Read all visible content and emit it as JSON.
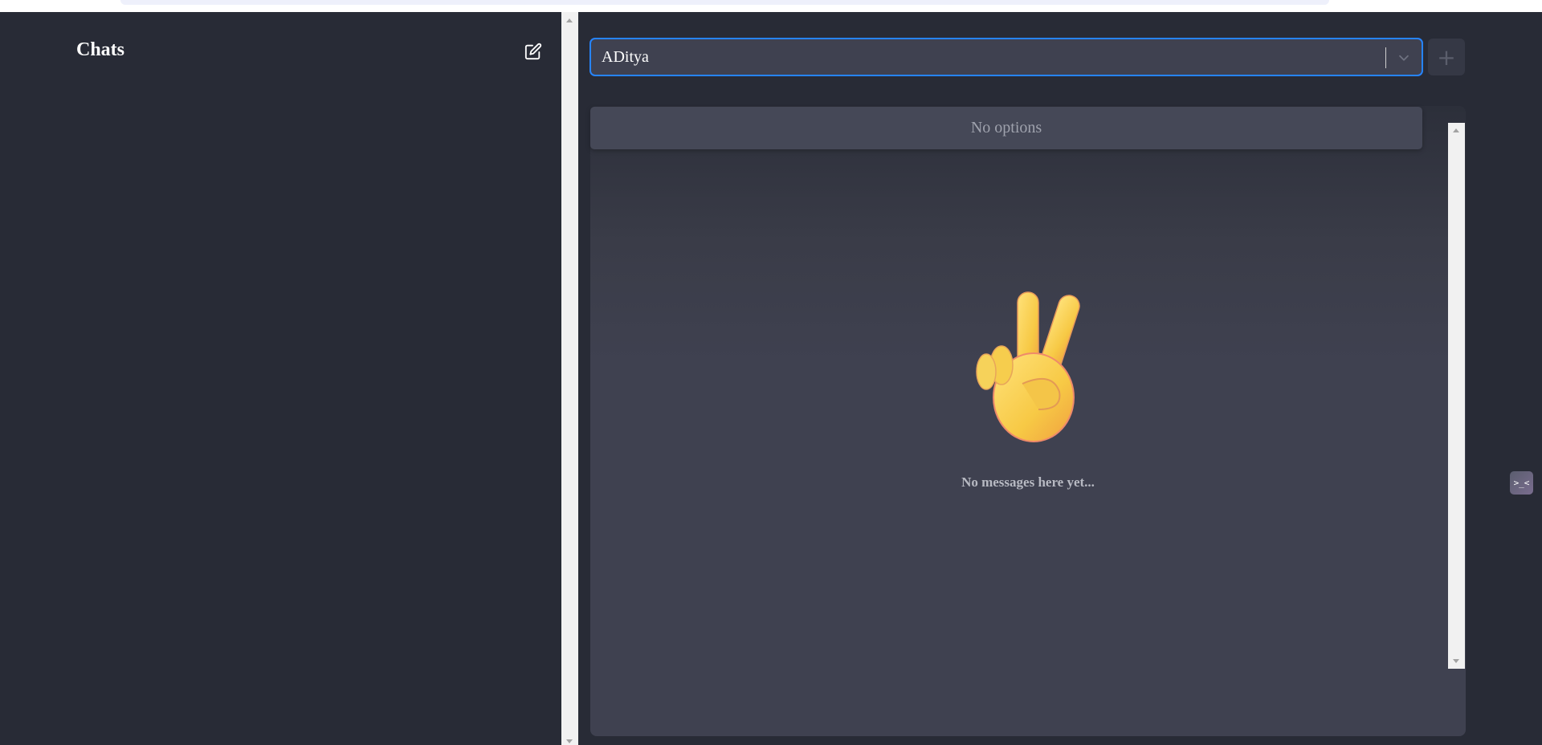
{
  "sidebar": {
    "title": "Chats",
    "compose_icon": "edit-square-icon"
  },
  "header": {
    "recipient_select": {
      "value": "ADitya",
      "chevron_icon": "chevron-down-icon",
      "dropdown_message": "No options"
    },
    "add_button_label": "+"
  },
  "chat": {
    "empty_state_icon": "victory-hand-emoji",
    "empty_state_text": "No messages here yet..."
  },
  "widget": {
    "label": ">_<",
    "icon": "emoticon-widget-icon"
  },
  "colors": {
    "background": "#282b36",
    "panel": "#3f4150",
    "accent_focus": "#2684ff"
  }
}
